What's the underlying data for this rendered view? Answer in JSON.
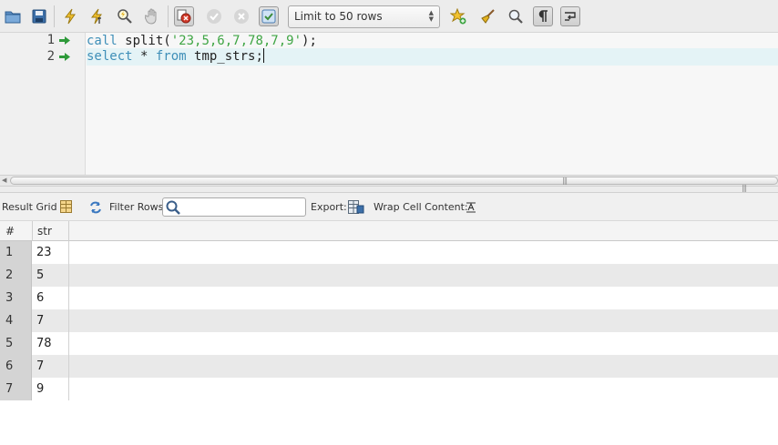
{
  "toolbar": {
    "limit_select_value": "Limit to 50 rows"
  },
  "editor": {
    "lines": [
      {
        "number": "1",
        "parts": [
          "call",
          " split(",
          "'23,5,6,7,78,7,9'",
          ");"
        ]
      },
      {
        "number": "2",
        "parts": [
          "select",
          " * ",
          "from",
          " tmp_strs;"
        ]
      }
    ]
  },
  "result_bar": {
    "result_grid_label": "Result Grid",
    "filter_rows_label": "Filter Rows:",
    "filter_placeholder": "",
    "export_label": "Export:",
    "wrap_label": "Wrap Cell Content:"
  },
  "grid": {
    "columns": [
      "#",
      "str"
    ],
    "rows": [
      {
        "num": "1",
        "str": "23"
      },
      {
        "num": "2",
        "str": "5"
      },
      {
        "num": "3",
        "str": "6"
      },
      {
        "num": "4",
        "str": "7"
      },
      {
        "num": "5",
        "str": "78"
      },
      {
        "num": "6",
        "str": "7"
      },
      {
        "num": "7",
        "str": "9"
      }
    ]
  },
  "colors": {
    "keyword": "#3f8fb8",
    "string": "#3fa544",
    "active_line": "#e4f3f6",
    "row_alt": "#e9e9e9"
  }
}
